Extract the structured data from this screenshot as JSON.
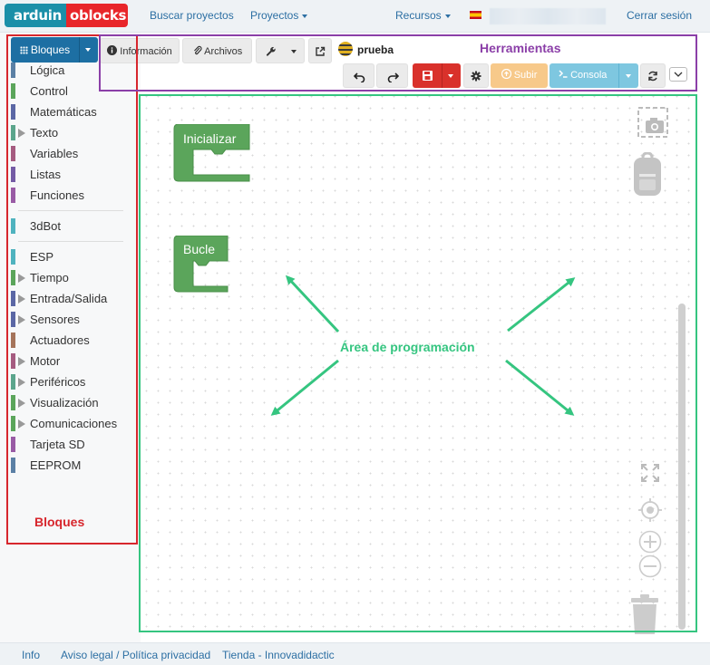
{
  "brand": {
    "logo_left": "arduin",
    "logo_right": "oblocks"
  },
  "navbar": {
    "search_projects": "Buscar proyectos",
    "projects": "Proyectos",
    "resources": "Recursos",
    "logout": "Cerrar sesión"
  },
  "sidebar": {
    "blocks_button": "Bloques",
    "categories": [
      {
        "label": "Lógica",
        "color": "#5b80a5",
        "expandable": false
      },
      {
        "label": "Control",
        "color": "#5ba55b",
        "expandable": false
      },
      {
        "label": "Matemáticas",
        "color": "#5b67a5",
        "expandable": false
      },
      {
        "label": "Texto",
        "color": "#5ba58c",
        "expandable": true
      },
      {
        "label": "Variables",
        "color": "#a55b80",
        "expandable": false
      },
      {
        "label": "Listas",
        "color": "#745ba5",
        "expandable": false
      },
      {
        "label": "Funciones",
        "color": "#995ba5",
        "expandable": false
      },
      {
        "label": "3dBot",
        "color": "#4fb3bf",
        "expandable": false,
        "separator_before": true
      },
      {
        "label": "ESP",
        "color": "#4fb3bf",
        "expandable": false,
        "separator_before": true
      },
      {
        "label": "Tiempo",
        "color": "#5ba55b",
        "expandable": true
      },
      {
        "label": "Entrada/Salida",
        "color": "#5b67a5",
        "expandable": true
      },
      {
        "label": "Sensores",
        "color": "#5b67a5",
        "expandable": true
      },
      {
        "label": "Actuadores",
        "color": "#a5745b",
        "expandable": false
      },
      {
        "label": "Motor",
        "color": "#a55b80",
        "expandable": true
      },
      {
        "label": "Periféricos",
        "color": "#5ba58c",
        "expandable": true
      },
      {
        "label": "Visualización",
        "color": "#5ba55b",
        "expandable": true
      },
      {
        "label": "Comunicaciones",
        "color": "#5ba55b",
        "expandable": true
      },
      {
        "label": "Tarjeta SD",
        "color": "#995ba5",
        "expandable": false
      },
      {
        "label": "EEPROM",
        "color": "#5b80a5",
        "expandable": false
      }
    ]
  },
  "toolbar": {
    "info": "Información",
    "files": "Archivos",
    "project_name": "prueba",
    "upload": "Subir",
    "console": "Consola"
  },
  "workspace": {
    "blocks": [
      {
        "label": "Inicializar"
      },
      {
        "label": "Bucle"
      }
    ]
  },
  "annotations": {
    "blocks_area": "Bloques",
    "tools_area": "Herramientas",
    "programming_area": "Área de programación",
    "colors": {
      "blocks": "#d7262d",
      "tools": "#8b3fa8",
      "programming": "#35c580"
    }
  },
  "footer": {
    "info": "Info",
    "legal": "Aviso legal / Política privacidad",
    "shop": "Tienda - Innovadidactic"
  }
}
